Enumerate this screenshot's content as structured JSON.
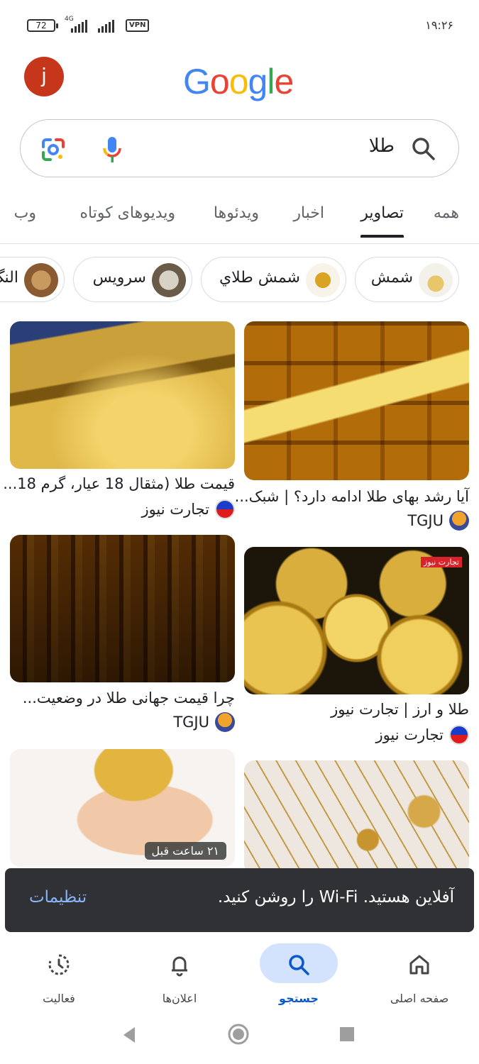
{
  "status_bar": {
    "battery": "72",
    "network": "4G",
    "vpn": "VPN",
    "time": "۱۹:۲۶"
  },
  "header": {
    "avatar_letter": "j",
    "logo_letters": [
      "G",
      "o",
      "o",
      "g",
      "l",
      "e"
    ]
  },
  "search": {
    "query": "طلا"
  },
  "tabs": [
    {
      "label": "همه",
      "active": false
    },
    {
      "label": "تصاویر",
      "active": true
    },
    {
      "label": "اخبار",
      "active": false
    },
    {
      "label": "ویدئوها",
      "active": false
    },
    {
      "label": "ویدیوهای کوتاه",
      "active": false
    },
    {
      "label": "وب",
      "active": false
    }
  ],
  "chips": [
    {
      "label": "شمش"
    },
    {
      "label": "شمش طلاي"
    },
    {
      "label": "سرویس"
    },
    {
      "label": "النگ"
    }
  ],
  "results": [
    {
      "caption": "آیا رشد بهای طلا ادامه دارد؟ | شبک...",
      "source": "TGJU",
      "favicon": "tgju-icon"
    },
    {
      "caption": "قیمت طلا (مثقال 18 عیار، گرم 18...",
      "source": "تجارت نیوز",
      "favicon": "tejarat-news-icon"
    },
    {
      "caption": "طلا و ارز | تجارت نیوز",
      "source": "تجارت نیوز",
      "favicon": "tejarat-news-icon",
      "overlay": "تجارت نیوز"
    },
    {
      "caption": "چرا قیمت جهانی طلا در وضعیت...",
      "source": "TGJU",
      "favicon": "tgju-icon"
    },
    {
      "caption": "",
      "source": ""
    },
    {
      "caption": "",
      "source": "",
      "time_badge": "۲۱ ساعت قبل"
    }
  ],
  "snackbar": {
    "message": "آفلاین هستید. Wi-Fi را روشن کنید.",
    "action": "تنظیمات"
  },
  "bottom_nav": [
    {
      "label": "صفحه اصلی",
      "icon": "home-icon",
      "active": false
    },
    {
      "label": "جستجو",
      "icon": "search-icon",
      "active": true
    },
    {
      "label": "اعلان‌ها",
      "icon": "bell-icon",
      "active": false
    },
    {
      "label": "فعالیت",
      "icon": "activity-icon",
      "active": false
    }
  ],
  "colors": {
    "accent": "#0b57d0",
    "nav_active_bg": "#d3e3fd",
    "snackbar_bg": "#303134",
    "snackbar_action": "#8ab4f8",
    "avatar_bg": "#c5361b"
  }
}
